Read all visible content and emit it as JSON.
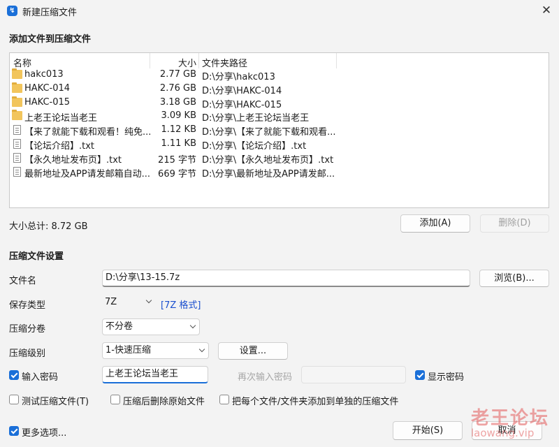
{
  "window": {
    "title": "新建压缩文件",
    "app_icon": "压缩软件图标"
  },
  "add_section": {
    "title": "添加文件到压缩文件",
    "columns": {
      "name": "名称",
      "size": "大小",
      "path": "文件夹路径"
    },
    "files": [
      {
        "icon": "folder-icon",
        "name": "hakc013",
        "size": "2.77 GB",
        "path": "D:\\分享\\hakc013"
      },
      {
        "icon": "folder-icon",
        "name": "HAKC-014",
        "size": "2.76 GB",
        "path": "D:\\分享\\HAKC-014"
      },
      {
        "icon": "folder-icon",
        "name": "HAKC-015",
        "size": "3.18 GB",
        "path": "D:\\分享\\HAKC-015"
      },
      {
        "icon": "folder-icon",
        "name": "上老王论坛当老王",
        "size": "3.09 KB",
        "path": "D:\\分享\\上老王论坛当老王"
      },
      {
        "icon": "file-icon",
        "name": "【来了就能下载和观看！纯免...",
        "size": "1.12 KB",
        "path": "D:\\分享\\【来了就能下载和观看..."
      },
      {
        "icon": "file-icon",
        "name": "【论坛介绍】.txt",
        "size": "1.11 KB",
        "path": "D:\\分享\\【论坛介绍】.txt"
      },
      {
        "icon": "file-icon",
        "name": "【永久地址发布页】.txt",
        "size": "215 字节",
        "path": "D:\\分享\\【永久地址发布页】.txt"
      },
      {
        "icon": "file-icon",
        "name": "最新地址及APP请发邮箱自动...",
        "size": "669 字节",
        "path": "D:\\分享\\最新地址及APP请发邮..."
      }
    ],
    "total_label": "大小总计: 8.72 GB",
    "add_button": "添加(A)",
    "delete_button": "删除(D)"
  },
  "settings": {
    "title": "压缩文件设置",
    "filename_label": "文件名",
    "filename_value": "D:\\分享\\13-15.7z",
    "browse_button": "浏览(B)...",
    "type_label": "保存类型",
    "type_value": "7Z",
    "type_link": "[7Z 格式]",
    "volume_label": "压缩分卷",
    "volume_value": "不分卷",
    "level_label": "压缩级别",
    "level_value": "1-快速压缩",
    "settings_button": "设置...",
    "password_label": "输入密码",
    "password_checked": true,
    "password_value": "上老王论坛当老王",
    "reenter_label": "再次输入密码",
    "show_password_label": "显示密码",
    "show_password_checked": true,
    "test_label": "测试压缩文件(T)",
    "delete_after_label": "压缩后删除原始文件",
    "separate_label": "把每个文件/文件夹添加到单独的压缩文件"
  },
  "footer": {
    "more_options_label": "更多选项...",
    "more_options_checked": true,
    "start_button": "开始(S)",
    "cancel_button": "取消"
  },
  "watermark": {
    "line1": "老王论坛",
    "line2": "laowang.vip"
  },
  "colors": {
    "accent": "#1a6fd8",
    "link": "#1a4fcf",
    "watermark": "#e35b5b"
  }
}
